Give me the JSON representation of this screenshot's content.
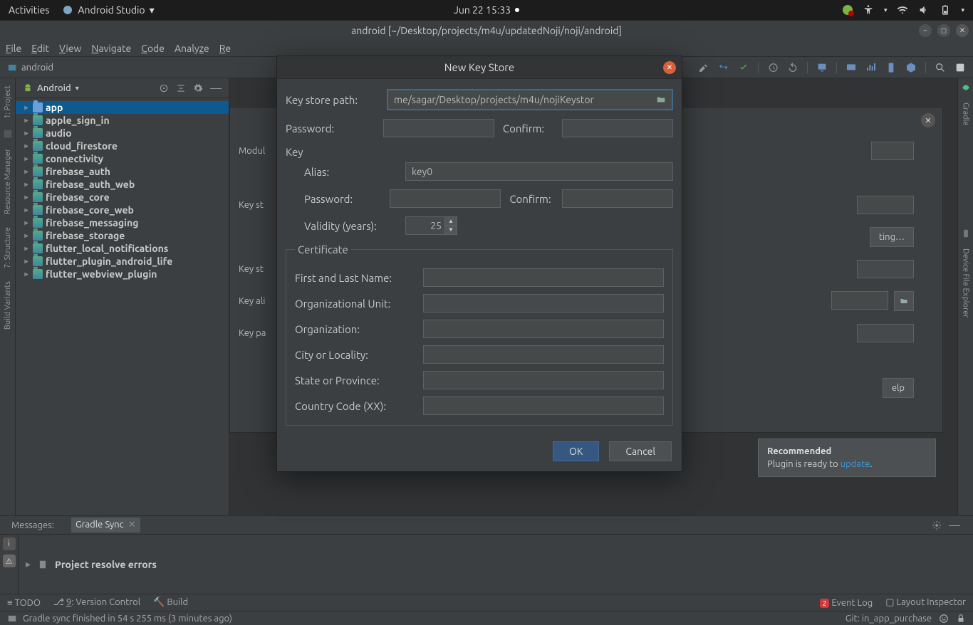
{
  "topbar": {
    "activities": "Activities",
    "app": "Android Studio",
    "datetime": "Jun 22  15:33"
  },
  "window": {
    "title": "android [~/Desktop/projects/m4u/updatedNoji/noji/android]"
  },
  "menu": [
    "File",
    "Edit",
    "View",
    "Navigate",
    "Code",
    "Analyze",
    "Re"
  ],
  "breadcrumb": "android",
  "project": {
    "label": "Android",
    "items": [
      {
        "name": "app",
        "bold": true,
        "sel": true,
        "lib": false
      },
      {
        "name": "apple_sign_in",
        "bold": true,
        "lib": true
      },
      {
        "name": "audio",
        "bold": true,
        "lib": true
      },
      {
        "name": "cloud_firestore",
        "bold": true,
        "lib": true
      },
      {
        "name": "connectivity",
        "bold": true,
        "lib": true
      },
      {
        "name": "firebase_auth",
        "bold": true,
        "lib": true
      },
      {
        "name": "firebase_auth_web",
        "bold": true,
        "lib": true
      },
      {
        "name": "firebase_core",
        "bold": true,
        "lib": true
      },
      {
        "name": "firebase_core_web",
        "bold": true,
        "lib": true
      },
      {
        "name": "firebase_messaging",
        "bold": true,
        "lib": true
      },
      {
        "name": "firebase_storage",
        "bold": true,
        "lib": true
      },
      {
        "name": "flutter_local_notifications",
        "bold": true,
        "lib": true
      },
      {
        "name": "flutter_plugin_android_life",
        "bold": true,
        "lib": true
      },
      {
        "name": "flutter_webview_plugin",
        "bold": true,
        "lib": true
      }
    ]
  },
  "left_tools": [
    "1: Project",
    "Resource Manager",
    "7: Structure",
    "Build Variants"
  ],
  "right_tools": [
    "Gradle",
    "Device File Explorer"
  ],
  "underlay": {
    "module_lbl": "Modul",
    "keystore_lbl": "Key st",
    "kspass_lbl": "Key st",
    "alias_lbl": "Key ali",
    "keypass_lbl": "Key pa",
    "existing_btn": "ting…",
    "help_btn": "elp"
  },
  "messages": {
    "tab_label": "Messages:",
    "active_tab": "Gradle Sync",
    "error_line": "Project resolve errors"
  },
  "notif": {
    "title": "Recommended",
    "body_prefix": "Plugin is ready to ",
    "link": "update",
    "suffix": "."
  },
  "toolstrip": {
    "todo": "TODO",
    "vcs": "9: Version Control",
    "build": "Build",
    "eventlog": "Event Log",
    "event_badge": "2",
    "inspector": "Layout Inspector"
  },
  "status": {
    "left": "Gradle sync finished in 54 s 255 ms (3 minutes ago)",
    "git": "Git: in_app_purchase"
  },
  "dialog": {
    "title": "New Key Store",
    "path_label": "Key store path:",
    "path_value": "me/sagar/Desktop/projects/m4u/nojiKeystor",
    "password_label": "Password:",
    "confirm_label": "Confirm:",
    "section_key": "Key",
    "alias_label": "Alias:",
    "alias_value": "key0",
    "validity_label": "Validity (years):",
    "validity_value": "25",
    "cert_legend": "Certificate",
    "cert_fields": [
      "First and Last Name:",
      "Organizational Unit:",
      "Organization:",
      "City or Locality:",
      "State or Province:",
      "Country Code (XX):"
    ],
    "ok": "OK",
    "cancel": "Cancel"
  }
}
